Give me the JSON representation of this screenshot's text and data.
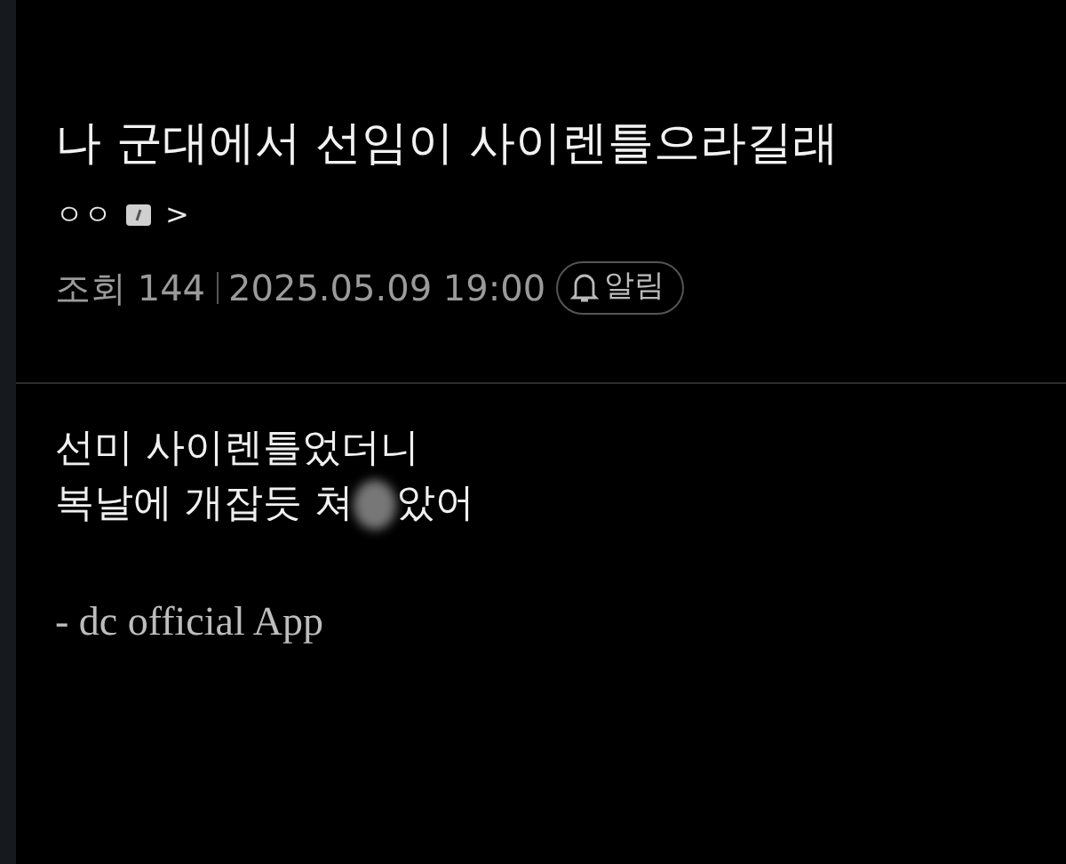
{
  "post": {
    "title": "나 군대에서 선임이 사이렌틀으라길래",
    "author": {
      "name": "ㅇㅇ",
      "chevron": ">"
    },
    "views_label": "조회 144",
    "datetime": "2025.05.09 19:00",
    "alert_button": "알림",
    "body": {
      "lines": [
        {
          "parts": [
            {
              "kind": "text",
              "text": "선미 사이렌틀었더니"
            }
          ]
        },
        {
          "parts": [
            {
              "kind": "text",
              "text": "복날에 개잡듯 쳐"
            },
            {
              "kind": "blur"
            },
            {
              "kind": "text",
              "text": "았어"
            }
          ]
        }
      ],
      "signature": "- dc official App"
    }
  }
}
